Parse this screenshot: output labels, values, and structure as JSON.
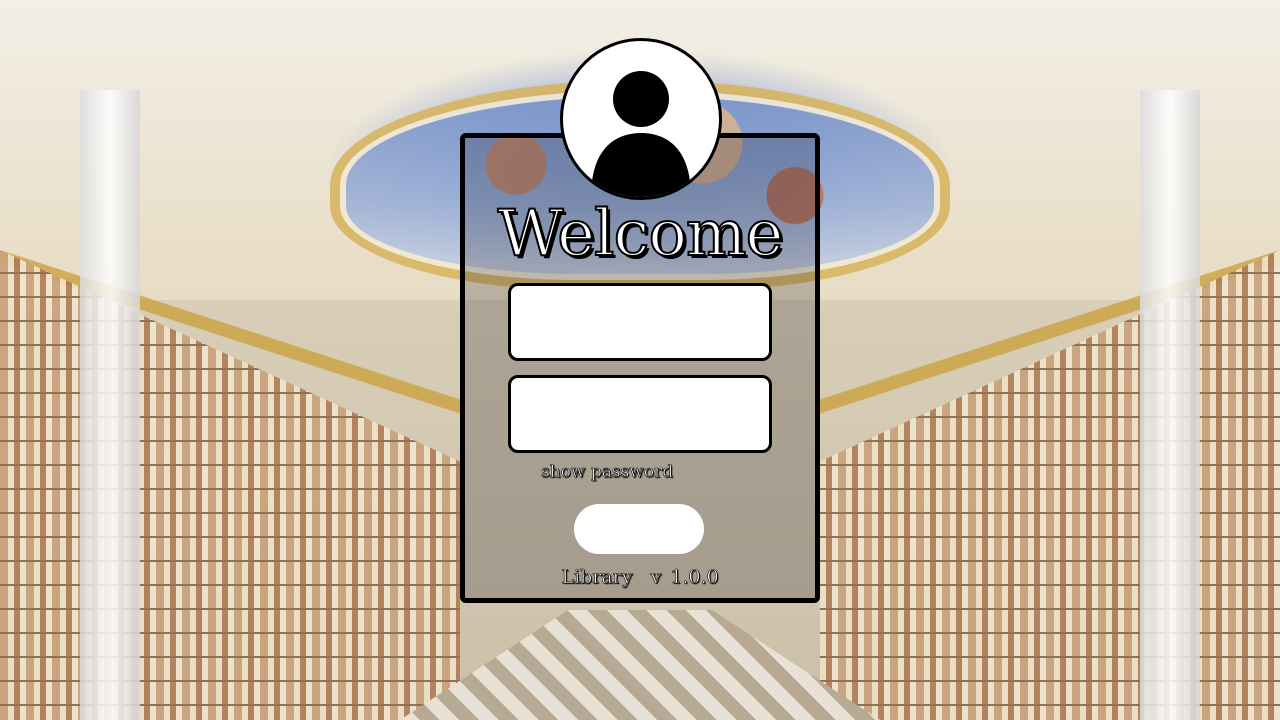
{
  "login": {
    "welcome_text": "Welcome",
    "username": {
      "value": "",
      "placeholder": ""
    },
    "password": {
      "value": "",
      "placeholder": ""
    },
    "show_password_label": "show password",
    "login_button_label": "",
    "version_label": "Library  v 1.0.0"
  },
  "icons": {
    "avatar": "user-avatar-icon"
  },
  "colors": {
    "card_border": "#000000",
    "field_background": "#ffffff",
    "text": "#ffffff"
  }
}
